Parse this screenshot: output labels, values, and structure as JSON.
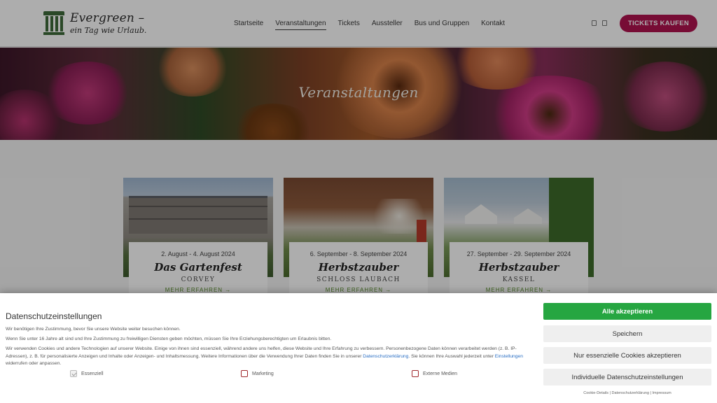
{
  "header": {
    "logo_title": "Evergreen –",
    "logo_subtitle": "ein Tag wie Urlaub.",
    "nav": [
      "Startseite",
      "Veranstaltungen",
      "Tickets",
      "Aussteller",
      "Bus und Gruppen",
      "Kontakt"
    ],
    "active_nav": "Veranstaltungen",
    "tickets_button": "TICKETS KAUFEN",
    "accent_color": "#b0124f"
  },
  "hero": {
    "title": "Veranstaltungen"
  },
  "events": [
    {
      "date": "2. August - 4. August 2024",
      "title": "Das Gartenfest",
      "location": "CORVEY",
      "more": "MEHR ERFAHREN →"
    },
    {
      "date": "6. September - 8. September 2024",
      "title": "Herbstzauber",
      "location": "SCHLOSS LAUBACH",
      "more": "MEHR ERFAHREN →"
    },
    {
      "date": "27. September - 29. September 2024",
      "title": "Herbstzauber",
      "location": "KASSEL",
      "more": "MEHR ERFAHREN →"
    }
  ],
  "cookie": {
    "title": "Datenschutzeinstellungen",
    "p1": "Wir benötigen Ihre Zustimmung, bevor Sie unsere Website weiter besuchen können.",
    "p2": "Wenn Sie unter 16 Jahre alt sind und Ihre Zustimmung zu freiwilligen Diensten geben möchten, müssen Sie Ihre Erziehungsberechtigten um Erlaubnis bitten.",
    "p3_a": "Wir verwenden Cookies und andere Technologien auf unserer Website. Einige von ihnen sind essenziell, während andere uns helfen, diese Website und Ihre Erfahrung zu verbessern. Personenbezogene Daten können verarbeitet werden (z. B. IP-Adressen), z. B. für personalisierte Anzeigen und Inhalte oder Anzeigen- und Inhaltsmessung. Weitere Informationen über die Verwendung Ihrer Daten finden Sie in unserer ",
    "p3_link1": "Datenschutzerklärung",
    "p3_b": ". Sie können Ihre Auswahl jederzeit unter ",
    "p3_link2": "Einstellungen",
    "p3_c": " widerrufen oder anpassen.",
    "checkboxes": [
      {
        "label": "Essenziell",
        "checked": true
      },
      {
        "label": "Marketing",
        "checked": false
      },
      {
        "label": "Externe Medien",
        "checked": false
      }
    ],
    "buttons": {
      "accept_all": "Alle akzeptieren",
      "save": "Speichern",
      "essential_only": "Nur essenzielle Cookies akzeptieren",
      "individual": "Individuelle Datenschutzeinstellungen"
    },
    "footer": {
      "cookie_details": "Cookie-Details",
      "privacy": "Datenschutzerklärung",
      "imprint": "Impressum",
      "separator": "|"
    },
    "accept_color": "#26a641"
  }
}
